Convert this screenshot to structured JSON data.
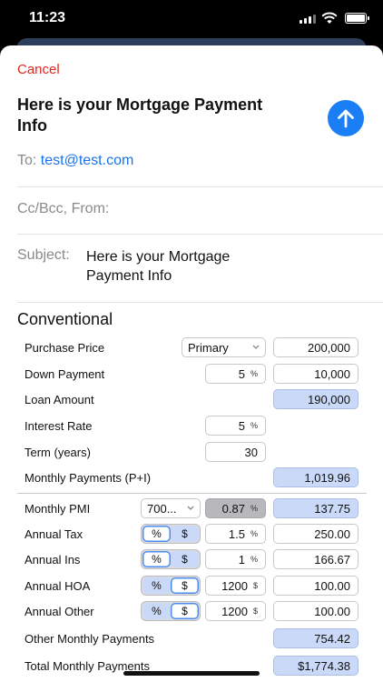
{
  "status": {
    "time": "11:23"
  },
  "compose": {
    "cancel_label": "Cancel",
    "title": "Here is your Mortgage Payment Info",
    "to_label": "To:",
    "to_value": "test@test.com",
    "ccbcc_label": "Cc/Bcc, From:",
    "subject_label": "Subject:",
    "subject_value": "Here is your Mortgage Payment Info"
  },
  "mortgage": {
    "section": "Conventional",
    "purchase_price": {
      "label": "Purchase Price",
      "type_option": "Primary",
      "value": "200,000"
    },
    "down_payment": {
      "label": "Down Payment",
      "percent": "5",
      "percent_unit": "%",
      "value": "10,000"
    },
    "loan_amount": {
      "label": "Loan Amount",
      "value": "190,000"
    },
    "interest_rate": {
      "label": "Interest Rate",
      "value": "5",
      "unit": "%"
    },
    "term": {
      "label": "Term (years)",
      "value": "30"
    },
    "monthly_payments": {
      "label": "Monthly Payments (P+I)",
      "value": "1,019.96"
    },
    "monthly_pmi": {
      "label": "Monthly PMI",
      "credit_option": "700...",
      "rate": "0.87",
      "rate_unit": "%",
      "value": "137.75"
    },
    "annual_tax": {
      "label": "Annual Tax",
      "mode_percent": "%",
      "mode_dollar": "$",
      "input": "1.5",
      "input_unit": "%",
      "value": "250.00"
    },
    "annual_ins": {
      "label": "Annual Ins",
      "mode_percent": "%",
      "mode_dollar": "$",
      "input": "1",
      "input_unit": "%",
      "value": "166.67"
    },
    "annual_hoa": {
      "label": "Annual HOA",
      "mode_percent": "%",
      "mode_dollar": "$",
      "input": "1200",
      "input_unit": "$",
      "value": "100.00"
    },
    "annual_other": {
      "label": "Annual Other",
      "mode_percent": "%",
      "mode_dollar": "$",
      "input": "1200",
      "input_unit": "$",
      "value": "100.00"
    },
    "other_monthly": {
      "label": "Other Monthly Payments",
      "value": "754.42"
    },
    "total_monthly": {
      "label": "Total Monthly Payments",
      "value": "$1,774.38"
    }
  }
}
